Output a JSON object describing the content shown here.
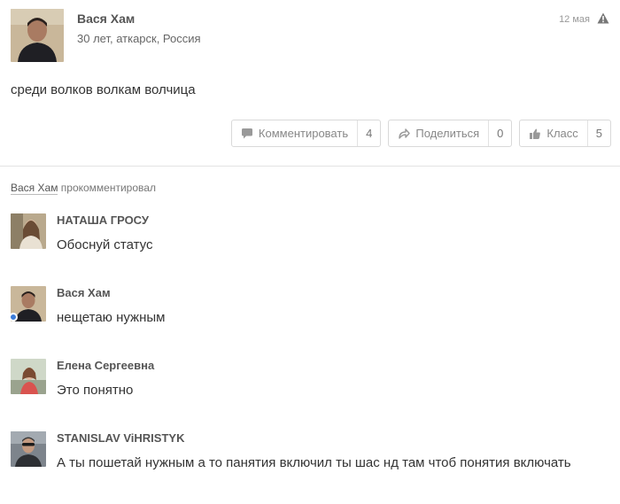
{
  "post": {
    "author": "Вася Хам",
    "meta": "30 лет, аткарск, Россия",
    "date": "12 мая",
    "text": "среди волков волкам волчица",
    "actions": [
      {
        "label": "Комментировать",
        "count": "4",
        "icon": "comment-icon"
      },
      {
        "label": "Поделиться",
        "count": "0",
        "icon": "share-icon"
      },
      {
        "label": "Класс",
        "count": "5",
        "icon": "like-icon"
      }
    ]
  },
  "commented_by": {
    "name": "Вася Хам",
    "action": "прокомментировал"
  },
  "comments": [
    {
      "author": "НАТАША ГРОСУ",
      "text": "Обоснуй статус"
    },
    {
      "author": "Вася Хам",
      "text": "нещетаю нужным",
      "online": true
    },
    {
      "author": "Елена Сергеевна",
      "text": "Это понятно"
    },
    {
      "author": "STANISLAV ViHRISTYK",
      "text": "А ты пошетай нужным а то панятия включил ты шас нд там чтоб понятия включать"
    }
  ],
  "colors": {
    "online": "#3b7bd8",
    "divider": "#e3e3e3"
  }
}
